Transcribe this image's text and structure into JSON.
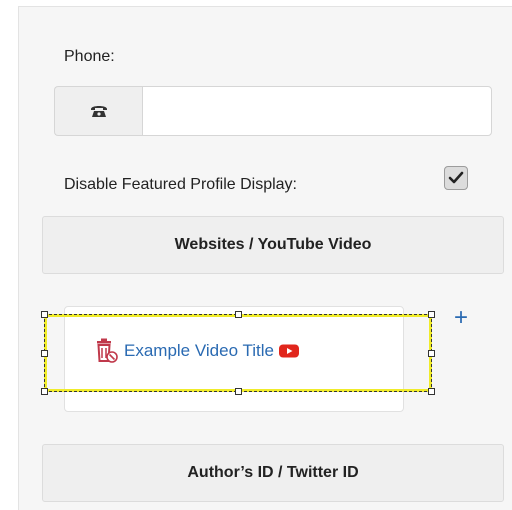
{
  "phone": {
    "label": "Phone:",
    "value": "",
    "placeholder": ""
  },
  "disable_featured": {
    "label": "Disable Featured Profile Display:",
    "checked": true
  },
  "sections": {
    "websites_label": "Websites / YouTube Video",
    "author_label": "Author’s ID / Twitter ID"
  },
  "video": {
    "title": "Example Video Title"
  },
  "add_label": "+",
  "colors": {
    "link": "#2a6ab2",
    "selection": "#f0ec2a",
    "trash": "#c0394b",
    "youtube": "#e1261c"
  }
}
